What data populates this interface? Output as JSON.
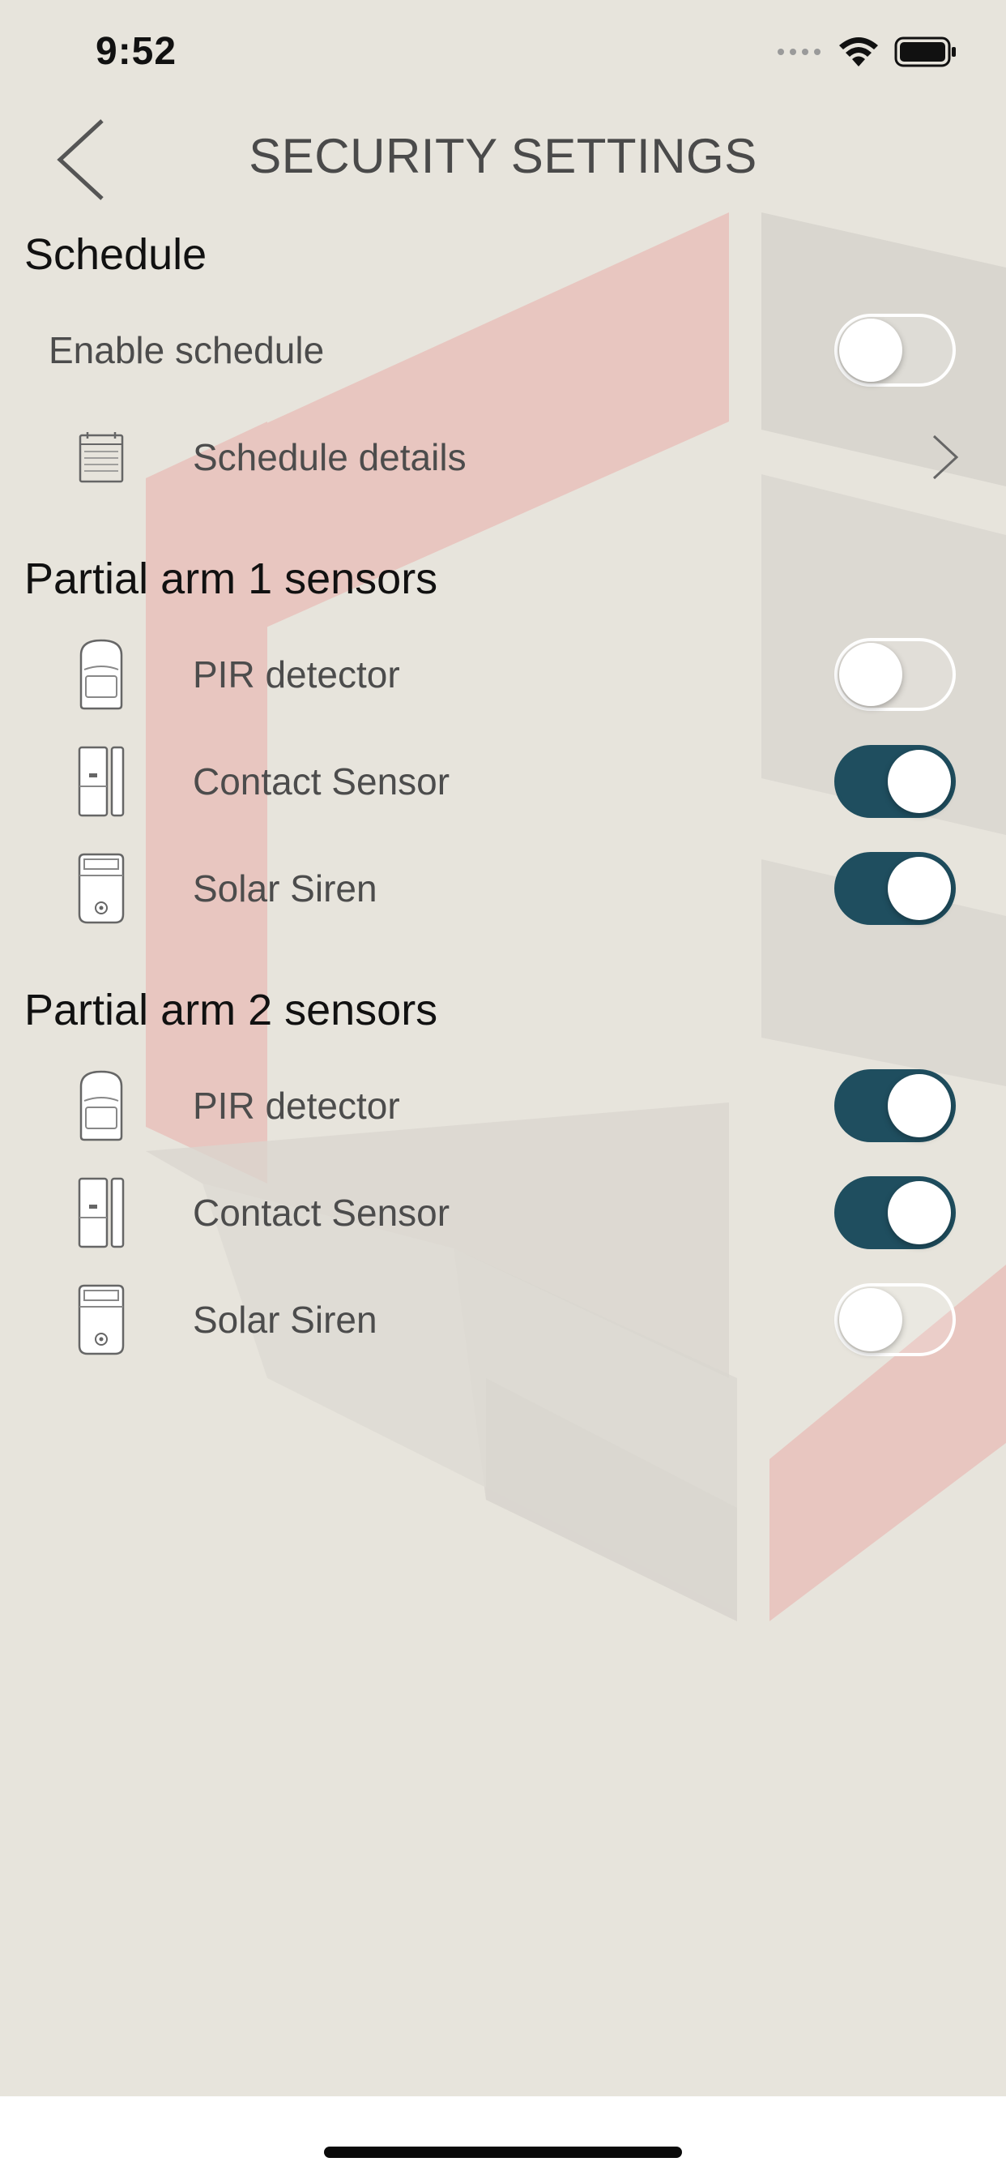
{
  "status_bar": {
    "time": "9:52",
    "icons": [
      "signal-dots-icon",
      "wifi-icon",
      "battery-icon"
    ]
  },
  "header": {
    "title": "SECURITY SETTINGS",
    "back_icon": "chevron-left-icon"
  },
  "schedule": {
    "title": "Schedule",
    "enable_label": "Enable schedule",
    "enable_on": false,
    "details_label": "Schedule details",
    "details_icon": "calendar-icon"
  },
  "partial1": {
    "title": "Partial arm 1 sensors",
    "items": [
      {
        "label": "PIR detector",
        "icon": "pir-detector-icon",
        "on": false
      },
      {
        "label": "Contact Sensor",
        "icon": "contact-sensor-icon",
        "on": true
      },
      {
        "label": "Solar Siren",
        "icon": "solar-siren-icon",
        "on": true
      }
    ]
  },
  "partial2": {
    "title": "Partial arm 2 sensors",
    "items": [
      {
        "label": "PIR detector",
        "icon": "pir-detector-icon",
        "on": true
      },
      {
        "label": "Contact Sensor",
        "icon": "contact-sensor-icon",
        "on": true
      },
      {
        "label": "Solar Siren",
        "icon": "solar-siren-icon",
        "on": false
      }
    ]
  },
  "colors": {
    "background": "#e7e4dc",
    "toggle_on": "#1f4e5f",
    "watermark_red": "#e8c6c0",
    "watermark_gray": "#d9d6cf"
  }
}
